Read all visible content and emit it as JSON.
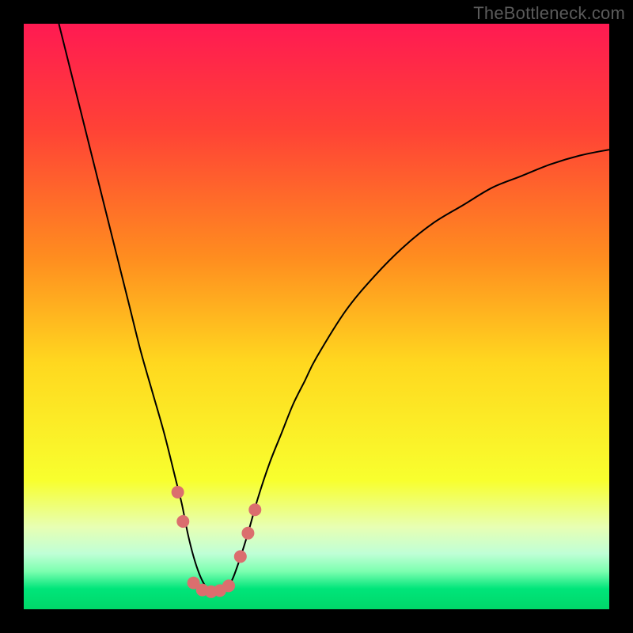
{
  "watermark": "TheBottleneck.com",
  "chart_data": {
    "type": "line",
    "title": "",
    "xlabel": "",
    "ylabel": "",
    "xlim": [
      0,
      100
    ],
    "ylim": [
      0,
      100
    ],
    "grid": false,
    "background": {
      "type": "vertical-gradient",
      "stops": [
        {
          "offset": 0.0,
          "color": "#ff1a52"
        },
        {
          "offset": 0.18,
          "color": "#ff4236"
        },
        {
          "offset": 0.4,
          "color": "#ff8d1f"
        },
        {
          "offset": 0.58,
          "color": "#ffd81f"
        },
        {
          "offset": 0.78,
          "color": "#f8ff2e"
        },
        {
          "offset": 0.86,
          "color": "#e7ffb4"
        },
        {
          "offset": 0.905,
          "color": "#bfffd6"
        },
        {
          "offset": 0.935,
          "color": "#7dffb0"
        },
        {
          "offset": 0.965,
          "color": "#00e57a"
        },
        {
          "offset": 1.0,
          "color": "#00d869"
        }
      ]
    },
    "series": [
      {
        "name": "bottleneck-curve",
        "color": "#000000",
        "stroke_width": 2,
        "x": [
          6,
          8,
          10,
          12,
          14,
          16,
          18,
          20,
          22,
          24,
          26,
          27,
          28,
          29,
          30,
          31,
          32,
          33,
          34,
          35,
          36,
          38,
          40,
          42,
          44,
          46,
          48,
          50,
          55,
          60,
          65,
          70,
          75,
          80,
          85,
          90,
          95,
          100
        ],
        "y": [
          100,
          92,
          84,
          76,
          68,
          60,
          52,
          44,
          37,
          30,
          22,
          18,
          13,
          9,
          6,
          4,
          3,
          3,
          3,
          4,
          6,
          12,
          19,
          25,
          30,
          35,
          39,
          43,
          51,
          57,
          62,
          66,
          69,
          72,
          74,
          76,
          77.5,
          78.5
        ]
      }
    ],
    "markers": [
      {
        "name": "curve-marker",
        "x": 26.3,
        "y": 20,
        "r": 8,
        "color": "#db6e6e"
      },
      {
        "name": "curve-marker",
        "x": 27.2,
        "y": 15,
        "r": 8,
        "color": "#db6e6e"
      },
      {
        "name": "curve-marker",
        "x": 29.0,
        "y": 4.5,
        "r": 8,
        "color": "#db6e6e"
      },
      {
        "name": "curve-marker",
        "x": 30.5,
        "y": 3.3,
        "r": 8,
        "color": "#db6e6e"
      },
      {
        "name": "curve-marker",
        "x": 32.0,
        "y": 3.0,
        "r": 8,
        "color": "#db6e6e"
      },
      {
        "name": "curve-marker",
        "x": 33.5,
        "y": 3.2,
        "r": 8,
        "color": "#db6e6e"
      },
      {
        "name": "curve-marker",
        "x": 35.0,
        "y": 4.0,
        "r": 8,
        "color": "#db6e6e"
      },
      {
        "name": "curve-marker",
        "x": 37.0,
        "y": 9,
        "r": 8,
        "color": "#db6e6e"
      },
      {
        "name": "curve-marker",
        "x": 38.3,
        "y": 13,
        "r": 8,
        "color": "#db6e6e"
      },
      {
        "name": "curve-marker",
        "x": 39.5,
        "y": 17,
        "r": 8,
        "color": "#db6e6e"
      }
    ]
  }
}
